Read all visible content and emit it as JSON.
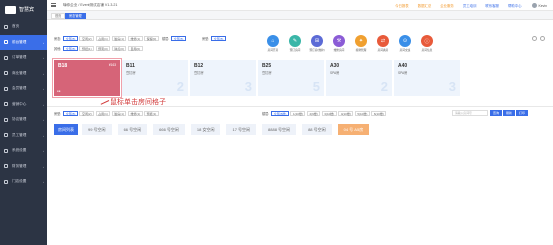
{
  "sidebar": {
    "brand": "智慧宾",
    "items": [
      {
        "label": "首页",
        "active": false
      },
      {
        "label": "前台管理",
        "active": true
      },
      {
        "label": "订单管理",
        "active": false
      },
      {
        "label": "商业管理",
        "active": false
      },
      {
        "label": "会员管理",
        "active": false
      },
      {
        "label": "营销中心",
        "active": false
      },
      {
        "label": "协议管理",
        "active": false
      },
      {
        "label": "员工管理",
        "active": false
      },
      {
        "label": "系统设置",
        "active": false
      },
      {
        "label": "财务管理",
        "active": false
      },
      {
        "label": "门店设置",
        "active": false
      }
    ]
  },
  "topbar": {
    "crumb": "嗨你企业 / Event测试店铺 V1.3.21",
    "links": [
      {
        "label": "今日报表",
        "tone": "orange"
      },
      {
        "label": "数据汇总",
        "tone": "orange"
      },
      {
        "label": "企业服务",
        "tone": "orange"
      },
      {
        "label": "员工培训",
        "tone": "blue"
      },
      {
        "label": "联系客服",
        "tone": "blue"
      },
      {
        "label": "帮助中心",
        "tone": "blue"
      }
    ],
    "user": "Kevin"
  },
  "tabs": [
    {
      "label": "首页",
      "active": false
    },
    {
      "label": "房态管理",
      "active": true
    }
  ],
  "filters": {
    "row1_label": "房态:",
    "row1": [
      "全部(5)",
      "空闲(2)",
      "占用(1)",
      "脏房(1)",
      "维修(1)",
      "保留(0)"
    ],
    "row1b_label": "楼层:",
    "row1b": [
      "全部(5)"
    ],
    "row1c_label": "房型:",
    "row1c": [
      "全部(5)"
    ],
    "row2_label": "其他:",
    "row2": [
      "全部(5)",
      "预抵(1)",
      "预离(0)",
      "钟点(0)",
      "自用(0)"
    ]
  },
  "actions": [
    {
      "label": "房间开房",
      "color": "#3a8fe8",
      "glyph": "⌂"
    },
    {
      "label": "预订房间",
      "color": "#3ab6a8",
      "glyph": "✎"
    },
    {
      "label": "预订房(维护)",
      "color": "#5c6bd6",
      "glyph": "⊞"
    },
    {
      "label": "维修房间",
      "color": "#8b5cd6",
      "glyph": "⚒"
    },
    {
      "label": "挂牌管理",
      "color": "#f0a030",
      "glyph": "✦"
    },
    {
      "label": "房间换房",
      "color": "#e85a3a",
      "glyph": "⇄"
    },
    {
      "label": "房间交班",
      "color": "#3a8fe8",
      "glyph": "⊙"
    },
    {
      "label": "房间信息",
      "color": "#e85a3a",
      "glyph": "ⓘ"
    }
  ],
  "rooms": [
    {
      "no": "B18",
      "sub": "",
      "big": "",
      "selected": true,
      "tr": "¥163",
      "bl": "●●"
    },
    {
      "no": "B11",
      "sub": "豆钉房",
      "big": "2",
      "selected": false
    },
    {
      "no": "B12",
      "sub": "豆钉房",
      "big": "3",
      "selected": false
    },
    {
      "no": "B25",
      "sub": "豆钉房",
      "big": "5",
      "selected": false
    },
    {
      "no": "A30",
      "sub": "SPA房",
      "big": "2",
      "selected": false
    },
    {
      "no": "A40",
      "sub": "SPA房",
      "big": "3",
      "selected": false
    }
  ],
  "annotation": "鼠标单击房间格子",
  "bottom": {
    "row_a_label": "房型:",
    "row_a": [
      "全部(5)",
      "空闲(2)",
      "占用(1)",
      "脏房(1)",
      "维修(1)",
      "预抵(1)"
    ],
    "row_a2_label": "楼层:",
    "row_a2": [
      "全部(5楼)",
      "1(10楼)",
      "2(9楼)",
      "3(10楼)",
      "4(10楼)",
      "5(10楼)",
      "6(10楼)"
    ],
    "search_placeholder": "请输入房间号",
    "search_btn": "查询",
    "btn2": "刷新",
    "btn3": "打印"
  },
  "room_strip": [
    {
      "label": "房间列表",
      "kind": "first"
    },
    {
      "label": "99 号空闲",
      "kind": "normal"
    },
    {
      "label": "66 号空闲",
      "kind": "normal"
    },
    {
      "label": "666 号空闲",
      "kind": "normal"
    },
    {
      "label": "18 女空闲",
      "kind": "normal"
    },
    {
      "label": "17 号空闲",
      "kind": "normal"
    },
    {
      "label": "8888 号空闲",
      "kind": "normal"
    },
    {
      "label": "88 号空闲",
      "kind": "normal"
    },
    {
      "label": "04 号 A5房",
      "kind": "orange"
    }
  ]
}
